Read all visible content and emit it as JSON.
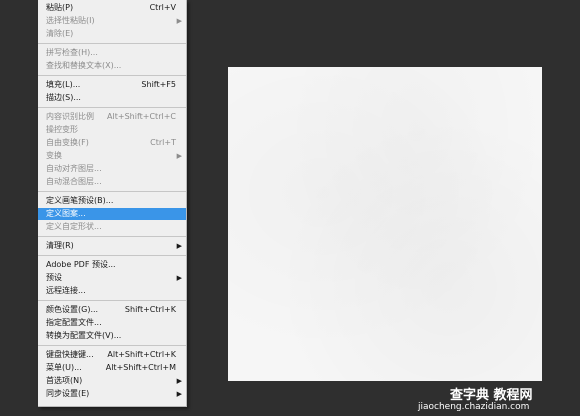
{
  "menu": {
    "items": [
      {
        "label": "粘贴(P)",
        "shortcut": "Ctrl+V",
        "state": "enabled",
        "arrow": false
      },
      {
        "label": "选择性粘贴(I)",
        "shortcut": "",
        "state": "disabled",
        "arrow": true
      },
      {
        "label": "清除(E)",
        "shortcut": "",
        "state": "disabled",
        "arrow": false
      },
      {
        "label": "拼写检查(H)...",
        "shortcut": "",
        "state": "disabled",
        "arrow": false
      },
      {
        "label": "查找和替换文本(X)...",
        "shortcut": "",
        "state": "disabled",
        "arrow": false
      },
      {
        "label": "填充(L)...",
        "shortcut": "Shift+F5",
        "state": "enabled",
        "arrow": false
      },
      {
        "label": "描边(S)...",
        "shortcut": "",
        "state": "enabled",
        "arrow": false
      },
      {
        "label": "内容识别比例",
        "shortcut": "Alt+Shift+Ctrl+C",
        "state": "disabled",
        "arrow": false
      },
      {
        "label": "操控变形",
        "shortcut": "",
        "state": "disabled",
        "arrow": false
      },
      {
        "label": "自由变换(F)",
        "shortcut": "Ctrl+T",
        "state": "disabled",
        "arrow": false
      },
      {
        "label": "变换",
        "shortcut": "",
        "state": "disabled",
        "arrow": true
      },
      {
        "label": "自动对齐图层...",
        "shortcut": "",
        "state": "disabled",
        "arrow": false
      },
      {
        "label": "自动混合图层...",
        "shortcut": "",
        "state": "disabled",
        "arrow": false
      },
      {
        "label": "定义画笔预设(B)...",
        "shortcut": "",
        "state": "enabled",
        "arrow": false
      },
      {
        "label": "定义图案...",
        "shortcut": "",
        "state": "highlighted",
        "arrow": false
      },
      {
        "label": "定义自定形状...",
        "shortcut": "",
        "state": "disabled",
        "arrow": false
      },
      {
        "label": "清理(R)",
        "shortcut": "",
        "state": "enabled",
        "arrow": true
      },
      {
        "label": "Adobe PDF 预设...",
        "shortcut": "",
        "state": "enabled",
        "arrow": false
      },
      {
        "label": "预设",
        "shortcut": "",
        "state": "enabled",
        "arrow": true
      },
      {
        "label": "远程连接...",
        "shortcut": "",
        "state": "enabled",
        "arrow": false
      },
      {
        "label": "颜色设置(G)...",
        "shortcut": "Shift+Ctrl+K",
        "state": "enabled",
        "arrow": false
      },
      {
        "label": "指定配置文件...",
        "shortcut": "",
        "state": "enabled",
        "arrow": false
      },
      {
        "label": "转换为配置文件(V)...",
        "shortcut": "",
        "state": "enabled",
        "arrow": false
      },
      {
        "label": "键盘快捷键...",
        "shortcut": "Alt+Shift+Ctrl+K",
        "state": "enabled",
        "arrow": false
      },
      {
        "label": "菜单(U)...",
        "shortcut": "Alt+Shift+Ctrl+M",
        "state": "enabled",
        "arrow": false
      },
      {
        "label": "首选项(N)",
        "shortcut": "",
        "state": "enabled",
        "arrow": true
      },
      {
        "label": "同步设置(E)",
        "shortcut": "",
        "state": "enabled",
        "arrow": true
      }
    ]
  },
  "watermark": {
    "line1": "查字典 教程网",
    "line2": "jiaocheng.chazidian.com"
  },
  "colors": {
    "workspace": "#2f2f2f",
    "menu_bg": "#efefef",
    "highlight": "#3a95e8",
    "canvas": "#f6f6f6"
  }
}
